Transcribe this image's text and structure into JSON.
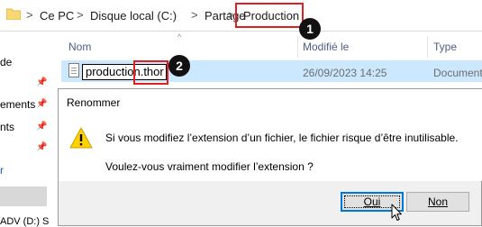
{
  "breadcrumb": {
    "items": [
      "Ce PC",
      "Disque local (C:)",
      "Partage",
      "Production"
    ],
    "separator": ">"
  },
  "annotations": {
    "badge_1": "1",
    "badge_2": "2",
    "highlight_color": "#e02020"
  },
  "nav": {
    "items": [
      "de",
      "ements",
      "nts",
      "r",
      "ADV (D:) S"
    ]
  },
  "columns": {
    "name": "Nom",
    "modified": "Modifié le",
    "type": "Type"
  },
  "file": {
    "rename_value": "production.thor",
    "modified": "26/09/2023 14:25",
    "type": "Document"
  },
  "dialog": {
    "title": "Renommer",
    "icon": "warning-icon",
    "message_line1": "Si vous modifiez l’extension d’un fichier, le fichier risque d’être inutilisable.",
    "message_line2": "Voulez-vous vraiment modifier l’extension ?",
    "yes_label": "Oui",
    "no_label": "Non"
  }
}
